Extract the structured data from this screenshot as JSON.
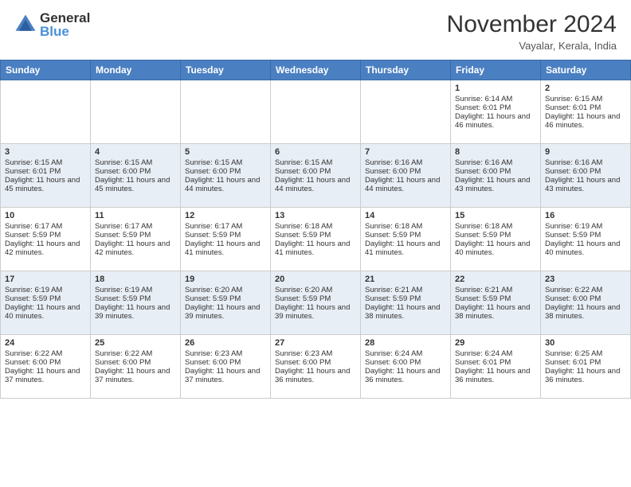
{
  "header": {
    "logo_general": "General",
    "logo_blue": "Blue",
    "month_title": "November 2024",
    "location": "Vayalar, Kerala, India"
  },
  "weekdays": [
    "Sunday",
    "Monday",
    "Tuesday",
    "Wednesday",
    "Thursday",
    "Friday",
    "Saturday"
  ],
  "rows": [
    [
      {
        "day": "",
        "sunrise": "",
        "sunset": "",
        "daylight": ""
      },
      {
        "day": "",
        "sunrise": "",
        "sunset": "",
        "daylight": ""
      },
      {
        "day": "",
        "sunrise": "",
        "sunset": "",
        "daylight": ""
      },
      {
        "day": "",
        "sunrise": "",
        "sunset": "",
        "daylight": ""
      },
      {
        "day": "",
        "sunrise": "",
        "sunset": "",
        "daylight": ""
      },
      {
        "day": "1",
        "sunrise": "Sunrise: 6:14 AM",
        "sunset": "Sunset: 6:01 PM",
        "daylight": "Daylight: 11 hours and 46 minutes."
      },
      {
        "day": "2",
        "sunrise": "Sunrise: 6:15 AM",
        "sunset": "Sunset: 6:01 PM",
        "daylight": "Daylight: 11 hours and 46 minutes."
      }
    ],
    [
      {
        "day": "3",
        "sunrise": "Sunrise: 6:15 AM",
        "sunset": "Sunset: 6:01 PM",
        "daylight": "Daylight: 11 hours and 45 minutes."
      },
      {
        "day": "4",
        "sunrise": "Sunrise: 6:15 AM",
        "sunset": "Sunset: 6:00 PM",
        "daylight": "Daylight: 11 hours and 45 minutes."
      },
      {
        "day": "5",
        "sunrise": "Sunrise: 6:15 AM",
        "sunset": "Sunset: 6:00 PM",
        "daylight": "Daylight: 11 hours and 44 minutes."
      },
      {
        "day": "6",
        "sunrise": "Sunrise: 6:15 AM",
        "sunset": "Sunset: 6:00 PM",
        "daylight": "Daylight: 11 hours and 44 minutes."
      },
      {
        "day": "7",
        "sunrise": "Sunrise: 6:16 AM",
        "sunset": "Sunset: 6:00 PM",
        "daylight": "Daylight: 11 hours and 44 minutes."
      },
      {
        "day": "8",
        "sunrise": "Sunrise: 6:16 AM",
        "sunset": "Sunset: 6:00 PM",
        "daylight": "Daylight: 11 hours and 43 minutes."
      },
      {
        "day": "9",
        "sunrise": "Sunrise: 6:16 AM",
        "sunset": "Sunset: 6:00 PM",
        "daylight": "Daylight: 11 hours and 43 minutes."
      }
    ],
    [
      {
        "day": "10",
        "sunrise": "Sunrise: 6:17 AM",
        "sunset": "Sunset: 5:59 PM",
        "daylight": "Daylight: 11 hours and 42 minutes."
      },
      {
        "day": "11",
        "sunrise": "Sunrise: 6:17 AM",
        "sunset": "Sunset: 5:59 PM",
        "daylight": "Daylight: 11 hours and 42 minutes."
      },
      {
        "day": "12",
        "sunrise": "Sunrise: 6:17 AM",
        "sunset": "Sunset: 5:59 PM",
        "daylight": "Daylight: 11 hours and 41 minutes."
      },
      {
        "day": "13",
        "sunrise": "Sunrise: 6:18 AM",
        "sunset": "Sunset: 5:59 PM",
        "daylight": "Daylight: 11 hours and 41 minutes."
      },
      {
        "day": "14",
        "sunrise": "Sunrise: 6:18 AM",
        "sunset": "Sunset: 5:59 PM",
        "daylight": "Daylight: 11 hours and 41 minutes."
      },
      {
        "day": "15",
        "sunrise": "Sunrise: 6:18 AM",
        "sunset": "Sunset: 5:59 PM",
        "daylight": "Daylight: 11 hours and 40 minutes."
      },
      {
        "day": "16",
        "sunrise": "Sunrise: 6:19 AM",
        "sunset": "Sunset: 5:59 PM",
        "daylight": "Daylight: 11 hours and 40 minutes."
      }
    ],
    [
      {
        "day": "17",
        "sunrise": "Sunrise: 6:19 AM",
        "sunset": "Sunset: 5:59 PM",
        "daylight": "Daylight: 11 hours and 40 minutes."
      },
      {
        "day": "18",
        "sunrise": "Sunrise: 6:19 AM",
        "sunset": "Sunset: 5:59 PM",
        "daylight": "Daylight: 11 hours and 39 minutes."
      },
      {
        "day": "19",
        "sunrise": "Sunrise: 6:20 AM",
        "sunset": "Sunset: 5:59 PM",
        "daylight": "Daylight: 11 hours and 39 minutes."
      },
      {
        "day": "20",
        "sunrise": "Sunrise: 6:20 AM",
        "sunset": "Sunset: 5:59 PM",
        "daylight": "Daylight: 11 hours and 39 minutes."
      },
      {
        "day": "21",
        "sunrise": "Sunrise: 6:21 AM",
        "sunset": "Sunset: 5:59 PM",
        "daylight": "Daylight: 11 hours and 38 minutes."
      },
      {
        "day": "22",
        "sunrise": "Sunrise: 6:21 AM",
        "sunset": "Sunset: 5:59 PM",
        "daylight": "Daylight: 11 hours and 38 minutes."
      },
      {
        "day": "23",
        "sunrise": "Sunrise: 6:22 AM",
        "sunset": "Sunset: 6:00 PM",
        "daylight": "Daylight: 11 hours and 38 minutes."
      }
    ],
    [
      {
        "day": "24",
        "sunrise": "Sunrise: 6:22 AM",
        "sunset": "Sunset: 6:00 PM",
        "daylight": "Daylight: 11 hours and 37 minutes."
      },
      {
        "day": "25",
        "sunrise": "Sunrise: 6:22 AM",
        "sunset": "Sunset: 6:00 PM",
        "daylight": "Daylight: 11 hours and 37 minutes."
      },
      {
        "day": "26",
        "sunrise": "Sunrise: 6:23 AM",
        "sunset": "Sunset: 6:00 PM",
        "daylight": "Daylight: 11 hours and 37 minutes."
      },
      {
        "day": "27",
        "sunrise": "Sunrise: 6:23 AM",
        "sunset": "Sunset: 6:00 PM",
        "daylight": "Daylight: 11 hours and 36 minutes."
      },
      {
        "day": "28",
        "sunrise": "Sunrise: 6:24 AM",
        "sunset": "Sunset: 6:00 PM",
        "daylight": "Daylight: 11 hours and 36 minutes."
      },
      {
        "day": "29",
        "sunrise": "Sunrise: 6:24 AM",
        "sunset": "Sunset: 6:01 PM",
        "daylight": "Daylight: 11 hours and 36 minutes."
      },
      {
        "day": "30",
        "sunrise": "Sunrise: 6:25 AM",
        "sunset": "Sunset: 6:01 PM",
        "daylight": "Daylight: 11 hours and 36 minutes."
      }
    ]
  ]
}
